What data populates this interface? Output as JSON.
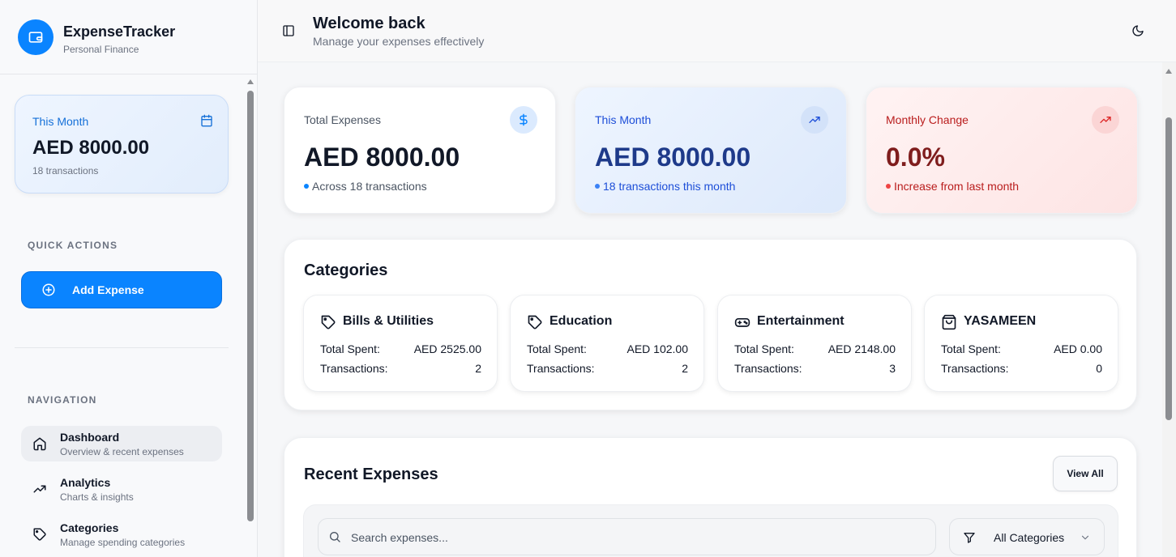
{
  "brand": {
    "title": "ExpenseTracker",
    "subtitle": "Personal Finance",
    "logo_icon": "wallet-icon"
  },
  "sidebar": {
    "summary": {
      "label": "This Month",
      "amount": "AED 8000.00",
      "count": "18 transactions",
      "icon": "calendar-icon"
    },
    "quick_actions_heading": "QUICK ACTIONS",
    "add_expense_label": "Add Expense",
    "navigation_heading": "NAVIGATION",
    "nav": [
      {
        "label": "Dashboard",
        "desc": "Overview & recent expenses",
        "icon": "home-icon",
        "active": true
      },
      {
        "label": "Analytics",
        "desc": "Charts & insights",
        "icon": "trending-up-icon",
        "active": false
      },
      {
        "label": "Categories",
        "desc": "Manage spending categories",
        "icon": "tag-icon",
        "active": false
      }
    ]
  },
  "header": {
    "title": "Welcome back",
    "subtitle": "Manage your expenses effectively",
    "theme_icon": "moon-icon",
    "panel_icon": "sidebar-toggle-icon"
  },
  "stats": [
    {
      "label": "Total Expenses",
      "value": "AED 8000.00",
      "sub": "Across 18 transactions",
      "icon": "dollar-icon"
    },
    {
      "label": "This Month",
      "value": "AED 8000.00",
      "sub": "18 transactions this month",
      "icon": "trending-up-icon"
    },
    {
      "label": "Monthly Change",
      "value": "0.0%",
      "sub": "Increase from last month",
      "icon": "trending-up-icon"
    }
  ],
  "categories": {
    "title": "Categories",
    "spent_label": "Total Spent:",
    "tx_label": "Transactions:",
    "items": [
      {
        "name": "Bills & Utilities",
        "spent": "AED 2525.00",
        "transactions": "2",
        "icon": "tag-icon"
      },
      {
        "name": "Education",
        "spent": "AED 102.00",
        "transactions": "2",
        "icon": "tag-icon"
      },
      {
        "name": "Entertainment",
        "spent": "AED 2148.00",
        "transactions": "3",
        "icon": "gamepad-icon"
      },
      {
        "name": "YASAMEEN",
        "spent": "AED 0.00",
        "transactions": "0",
        "icon": "shopping-bag-icon"
      }
    ]
  },
  "recent": {
    "title": "Recent Expenses",
    "view_all": "View All",
    "search_placeholder": "Search expenses...",
    "category_filter": "All Categories"
  },
  "colors": {
    "accent": "#0a84ff",
    "danger": "#b91c1c",
    "primary_dark": "#1e3a8a"
  }
}
